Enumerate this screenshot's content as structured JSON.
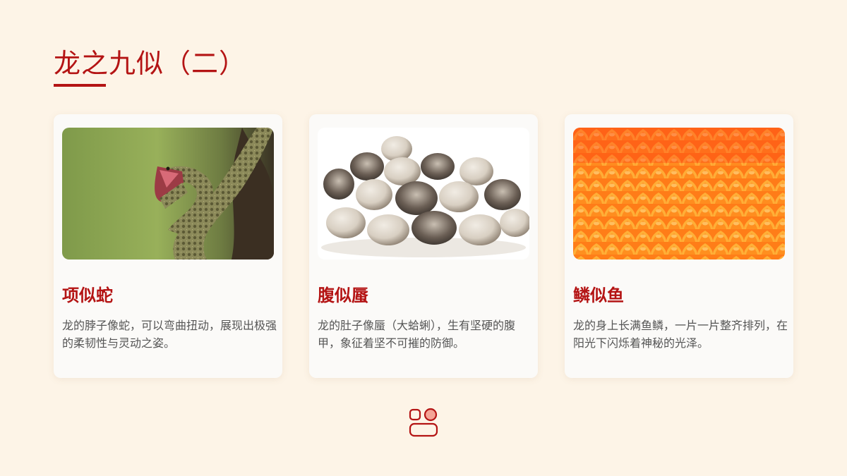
{
  "title": "龙之九似（二）",
  "colors": {
    "accent": "#b41414",
    "background": "#fdf4e7",
    "card": "#fbfaf8",
    "body_text": "#555555"
  },
  "cards": [
    {
      "heading": "项似蛇",
      "text": "龙的脖子像蛇，可以弯曲扭动，展现出极强的柔韧性与灵动之姿。",
      "image": "snake-photo"
    },
    {
      "heading": "腹似蜃",
      "text": "龙的肚子像蜃（大蛤蜊），生有坚硬的腹甲，象征着坚不可摧的防御。",
      "image": "clams-photo"
    },
    {
      "heading": "鳞似鱼",
      "text": "龙的身上长满鱼鳞，一片一片整齐排列，在阳光下闪烁着神秘的光泽。",
      "image": "fish-scales-photo"
    }
  ],
  "footer_icon": "layout-icon"
}
